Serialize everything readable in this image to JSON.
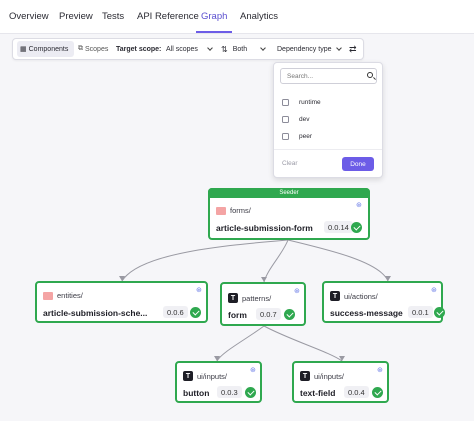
{
  "tabs": [
    {
      "label": "Overview"
    },
    {
      "label": "Preview"
    },
    {
      "label": "Tests"
    },
    {
      "label": "API Reference"
    },
    {
      "label": "Graph"
    },
    {
      "label": "Analytics"
    }
  ],
  "active_tab": "Graph",
  "toolbar": {
    "components_label": "Components",
    "scopes_label": "Scopes",
    "target_scope_label": "Target scope:",
    "target_scope_value": "All scopes",
    "both_label": "Both",
    "dependency_type_label": "Dependency type"
  },
  "dropdown": {
    "search_placeholder": "Search...",
    "options": [
      {
        "label": "runtime",
        "checked": false
      },
      {
        "label": "dev",
        "checked": false
      },
      {
        "label": "peer",
        "checked": false
      }
    ],
    "clear_label": "Clear",
    "done_label": "Done"
  },
  "graph": {
    "nodes": [
      {
        "id": "article-submission-form",
        "badge": "Seeder",
        "namespace": "forms/",
        "name": "article-submission-form",
        "version": "0.0.14",
        "icon": "folder-icon",
        "status": "passing"
      },
      {
        "id": "article-submission-schema",
        "namespace": "entities/",
        "name": "article-submission-sche...",
        "version": "0.0.6",
        "icon": "folder-icon",
        "status": "passing"
      },
      {
        "id": "form",
        "namespace": "patterns/",
        "name": "form",
        "version": "0.0.7",
        "icon": "typescript-icon",
        "status": "passing"
      },
      {
        "id": "success-message",
        "namespace": "ui/actions/",
        "name": "success-message",
        "version": "0.0.1",
        "icon": "typescript-icon",
        "status": "passing"
      },
      {
        "id": "button",
        "namespace": "ui/inputs/",
        "name": "button",
        "version": "0.0.3",
        "icon": "typescript-icon",
        "status": "passing"
      },
      {
        "id": "text-field",
        "namespace": "ui/inputs/",
        "name": "text-field",
        "version": "0.0.4",
        "icon": "typescript-icon",
        "status": "passing"
      }
    ],
    "edges": [
      {
        "from": "article-submission-form",
        "to": "article-submission-schema"
      },
      {
        "from": "article-submission-form",
        "to": "form"
      },
      {
        "from": "article-submission-form",
        "to": "success-message"
      },
      {
        "from": "form",
        "to": "button"
      },
      {
        "from": "form",
        "to": "text-field"
      }
    ]
  },
  "colors": {
    "accent": "#6c5ce7",
    "node_border": "#2fa84f",
    "edge": "#9a9aa3",
    "folder_icon": "#f4a4a4"
  },
  "icon_glyphs": {
    "typescript": "T",
    "env": "⊛"
  }
}
